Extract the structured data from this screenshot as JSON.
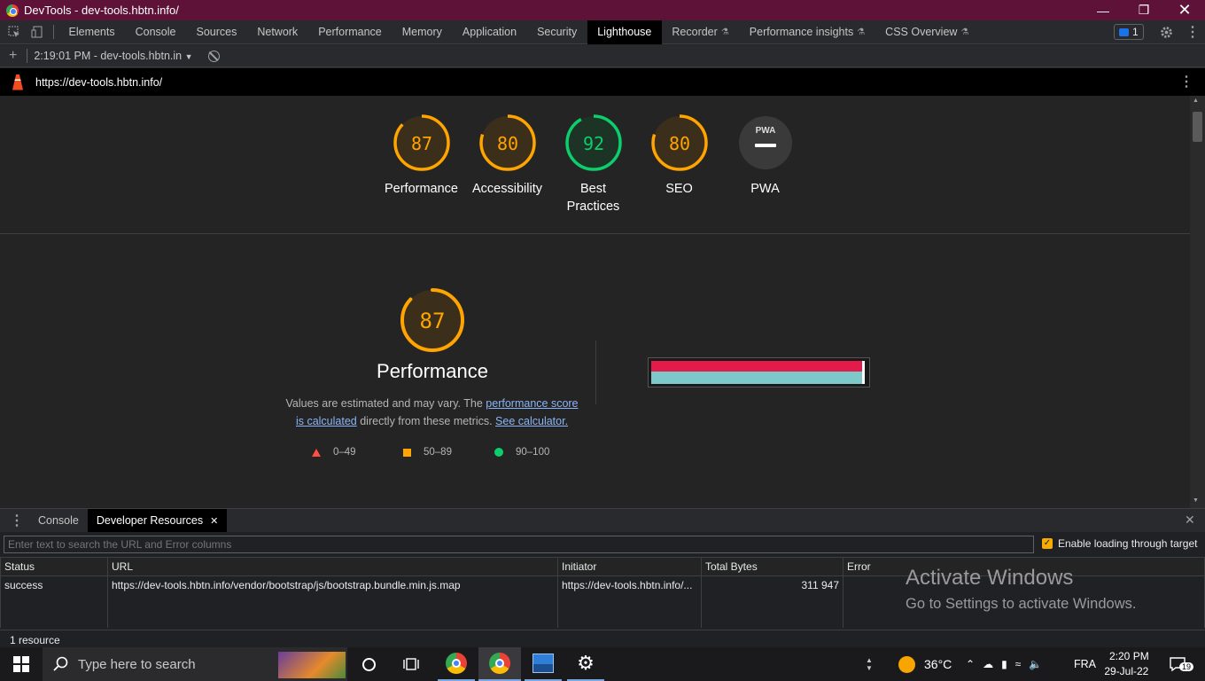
{
  "window": {
    "title": "DevTools - dev-tools.hbtn.info/"
  },
  "tabs": [
    {
      "label": "Elements",
      "flask": false,
      "active": false
    },
    {
      "label": "Console",
      "flask": false,
      "active": false
    },
    {
      "label": "Sources",
      "flask": false,
      "active": false
    },
    {
      "label": "Network",
      "flask": false,
      "active": false
    },
    {
      "label": "Performance",
      "flask": false,
      "active": false
    },
    {
      "label": "Memory",
      "flask": false,
      "active": false
    },
    {
      "label": "Application",
      "flask": false,
      "active": false
    },
    {
      "label": "Security",
      "flask": false,
      "active": false
    },
    {
      "label": "Lighthouse",
      "flask": false,
      "active": true
    },
    {
      "label": "Recorder",
      "flask": true,
      "active": false
    },
    {
      "label": "Performance insights",
      "flask": true,
      "active": false
    },
    {
      "label": "CSS Overview",
      "flask": true,
      "active": false
    }
  ],
  "issues_count": "1",
  "report_selector": "2:19:01 PM - dev-tools.hbtn.in",
  "report_url": "https://dev-tools.hbtn.info/",
  "gauges": [
    {
      "score": "87",
      "label": "Performance",
      "value": 87,
      "color": "#ffa400",
      "bg": "#3b2e1a"
    },
    {
      "score": "80",
      "label": "Accessibility",
      "value": 80,
      "color": "#ffa400",
      "bg": "#3b2e1a"
    },
    {
      "score": "92",
      "label": "Best Practices",
      "value": 92,
      "color": "#0cce6b",
      "bg": "#1c3326"
    },
    {
      "score": "80",
      "label": "SEO",
      "value": 80,
      "color": "#ffa400",
      "bg": "#3b2e1a"
    },
    {
      "score": "",
      "label": "PWA",
      "badge": "PWA",
      "value": 0,
      "color": "#9e9e9e",
      "bg": "#3a3a3a"
    }
  ],
  "performance": {
    "score": "87",
    "value": 87,
    "title": "Performance",
    "desc_prefix": "Values are estimated and may vary. The ",
    "desc_link1": "performance score is calculated",
    "desc_mid": " directly from these metrics. ",
    "desc_link2": "See calculator."
  },
  "legend": [
    {
      "shape": "triangle",
      "range": "0–49",
      "color": "#ff4e42"
    },
    {
      "shape": "square",
      "range": "50–89",
      "color": "#ffa400"
    },
    {
      "shape": "circle",
      "range": "90–100",
      "color": "#0cce6b"
    }
  ],
  "drawer": {
    "tabs": [
      {
        "label": "Console",
        "closable": false,
        "active": false
      },
      {
        "label": "Developer Resources",
        "closable": true,
        "active": true
      }
    ],
    "filter_placeholder": "Enter text to search the URL and Error columns",
    "enable_label": "Enable loading through target",
    "columns": [
      "Status",
      "URL",
      "Initiator",
      "Total Bytes",
      "Error"
    ],
    "rows": [
      {
        "status": "success",
        "url": "https://dev-tools.hbtn.info/vendor/bootstrap/js/bootstrap.bundle.min.js.map",
        "initiator": "https://dev-tools.hbtn.info/...",
        "bytes": "311 947",
        "error": ""
      }
    ],
    "summary": "1 resource"
  },
  "watermark": {
    "line1": "Activate Windows",
    "line2": "Go to Settings to activate Windows."
  },
  "taskbar": {
    "search_placeholder": "Type here to search",
    "temperature": "36°C",
    "language": "FRA",
    "time": "2:20 PM",
    "date": "29-Jul-22",
    "notifications": "19"
  }
}
